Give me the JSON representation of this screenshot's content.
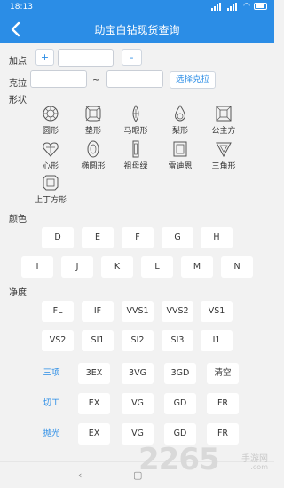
{
  "status": {
    "time": "18:13"
  },
  "header": {
    "title": "助宝白钻现货查询"
  },
  "markup": {
    "label": "加点",
    "plus": "+",
    "minus": "-"
  },
  "carat": {
    "label": "克拉",
    "tilde": "~",
    "select_button": "选择克拉"
  },
  "shape": {
    "label": "形状",
    "items": [
      {
        "label": "圆形",
        "icon": "round-diamond-icon"
      },
      {
        "label": "垫形",
        "icon": "cushion-diamond-icon"
      },
      {
        "label": "马眼形",
        "icon": "marquise-diamond-icon"
      },
      {
        "label": "梨形",
        "icon": "pear-diamond-icon"
      },
      {
        "label": "公主方",
        "icon": "princess-diamond-icon"
      },
      {
        "label": "心形",
        "icon": "heart-diamond-icon"
      },
      {
        "label": "椭圆形",
        "icon": "oval-diamond-icon"
      },
      {
        "label": "祖母绿",
        "icon": "emerald-diamond-icon"
      },
      {
        "label": "雷迪恩",
        "icon": "radiant-diamond-icon"
      },
      {
        "label": "三角形",
        "icon": "triangle-diamond-icon"
      },
      {
        "label": "上丁方形",
        "icon": "asscher-diamond-icon"
      }
    ]
  },
  "color": {
    "label": "颜色",
    "row1": [
      "D",
      "E",
      "F",
      "G",
      "H"
    ],
    "row2": [
      "I",
      "J",
      "K",
      "L",
      "M",
      "N"
    ]
  },
  "clarity": {
    "label": "净度",
    "row1": [
      "FL",
      "IF",
      "VVS1",
      "VVS2",
      "VS1"
    ],
    "row2": [
      "VS2",
      "SI1",
      "SI2",
      "SI3",
      "I1"
    ]
  },
  "three_ex": {
    "label": "三项",
    "options": [
      "3EX",
      "3VG",
      "3GD",
      "清空"
    ]
  },
  "cut": {
    "label": "切工",
    "options": [
      "EX",
      "VG",
      "GD",
      "FR"
    ]
  },
  "polish": {
    "label": "抛光",
    "options": [
      "EX",
      "VG",
      "GD",
      "FR"
    ]
  },
  "watermark": {
    "number": "2265",
    "cn": "手游网",
    "url": ".com"
  },
  "colors": {
    "accent": "#2b8de6",
    "background": "#f2f2f2"
  }
}
